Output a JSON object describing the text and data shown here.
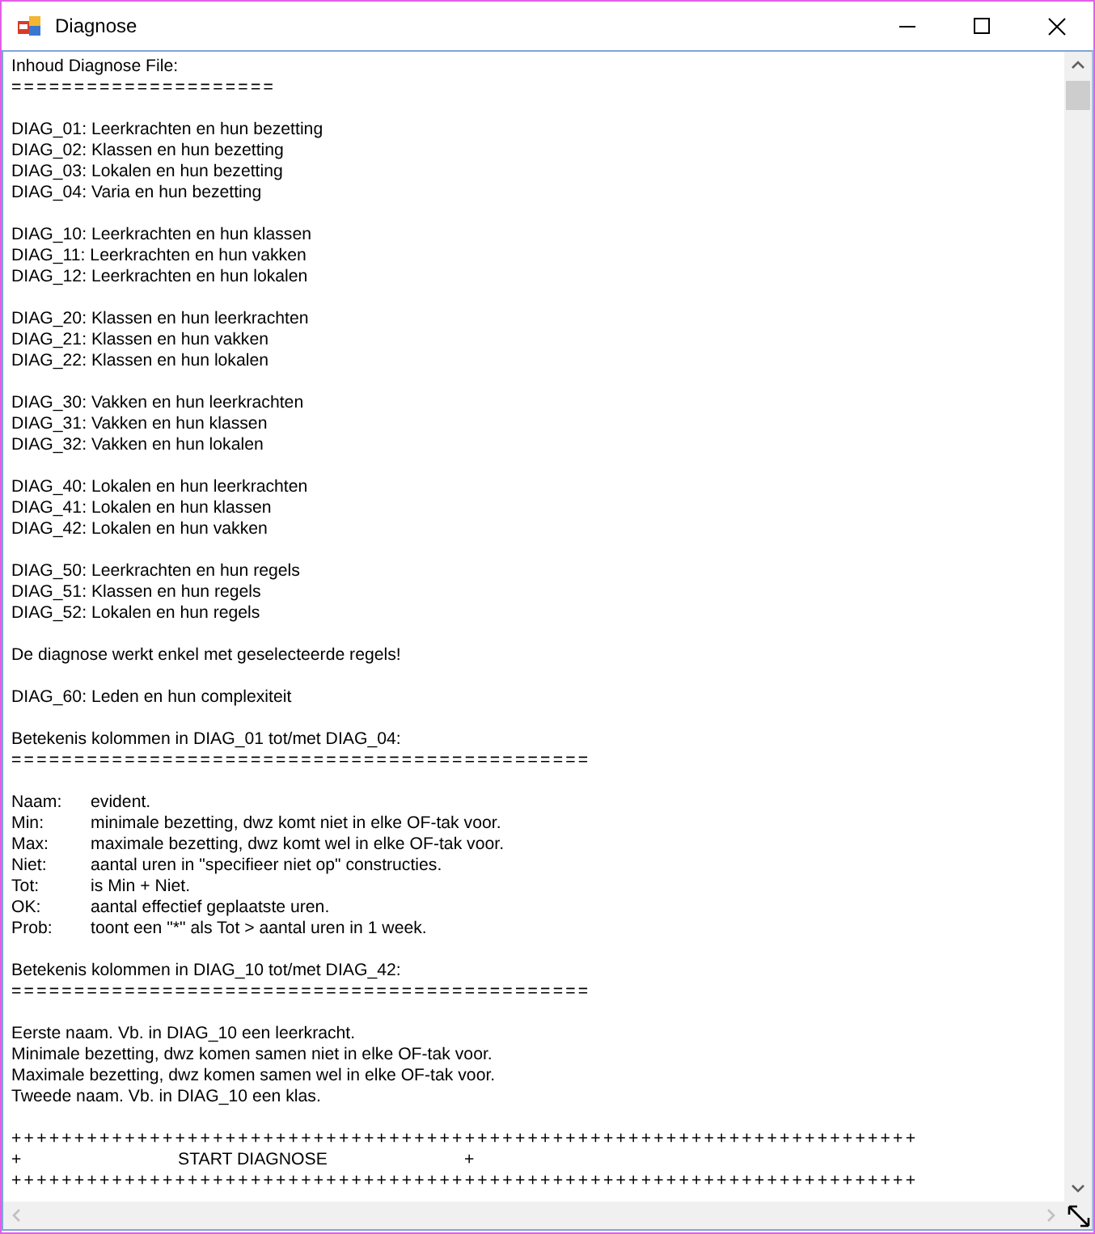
{
  "window": {
    "title": "Diagnose"
  },
  "text_box": {
    "blocks": [
      {
        "kind": "lines",
        "lines": [
          "Inhoud Diagnose File:",
          "====================="
        ]
      },
      {
        "kind": "lines",
        "lines": [
          "DIAG_01: Leerkrachten en hun bezetting",
          "DIAG_02: Klassen en hun bezetting",
          "DIAG_03: Lokalen en hun bezetting",
          "DIAG_04: Varia en hun bezetting"
        ]
      },
      {
        "kind": "lines",
        "lines": [
          "DIAG_10: Leerkrachten en hun klassen",
          "DIAG_11: Leerkrachten en hun vakken",
          "DIAG_12: Leerkrachten en hun lokalen"
        ]
      },
      {
        "kind": "lines",
        "lines": [
          "DIAG_20: Klassen en hun leerkrachten",
          "DIAG_21: Klassen en hun vakken",
          "DIAG_22: Klassen en hun lokalen"
        ]
      },
      {
        "kind": "lines",
        "lines": [
          "DIAG_30: Vakken en hun leerkrachten",
          "DIAG_31: Vakken en hun klassen",
          "DIAG_32: Vakken en hun lokalen"
        ]
      },
      {
        "kind": "lines",
        "lines": [
          "DIAG_40: Lokalen en hun leerkrachten",
          "DIAG_41: Lokalen en hun klassen",
          "DIAG_42: Lokalen en hun vakken"
        ]
      },
      {
        "kind": "lines",
        "lines": [
          "DIAG_50: Leerkrachten en hun regels",
          "DIAG_51: Klassen en hun regels",
          "DIAG_52: Lokalen en hun regels"
        ]
      },
      {
        "kind": "lines",
        "lines": [
          "De diagnose werkt enkel met geselecteerde regels!"
        ]
      },
      {
        "kind": "lines",
        "lines": [
          "DIAG_60: Leden en hun complexiteit"
        ]
      },
      {
        "kind": "lines",
        "lines": [
          "Betekenis kolommen in DIAG_01 tot/met DIAG_04:",
          "=============================================="
        ]
      },
      {
        "kind": "definitions",
        "items": [
          {
            "term": "Naam:",
            "text": "evident."
          },
          {
            "term": "Min:",
            "text": "minimale bezetting, dwz komt niet in elke OF-tak voor."
          },
          {
            "term": "Max:",
            "text": "maximale bezetting, dwz komt wel in elke OF-tak voor."
          },
          {
            "term": "Niet:",
            "text": "aantal uren in \"specifieer niet op\" constructies."
          },
          {
            "term": "Tot:",
            "text": "is Min + Niet."
          },
          {
            "term": "OK:",
            "text": "aantal effectief geplaatste uren."
          },
          {
            "term": "Prob:",
            "text": "toont een \"*\" als Tot > aantal uren in 1 week."
          }
        ]
      },
      {
        "kind": "lines",
        "lines": [
          "Betekenis kolommen in DIAG_10 tot/met DIAG_42:",
          "=============================================="
        ]
      },
      {
        "kind": "lines",
        "lines": [
          "Eerste naam. Vb. in DIAG_10 een leerkracht.",
          "Minimale bezetting, dwz komen samen niet in elke OF-tak voor.",
          "Maximale bezetting, dwz komen samen wel in elke OF-tak voor.",
          "Tweede naam. Vb. in DIAG_10 een klas."
        ]
      },
      {
        "kind": "banner",
        "border": "++++++++++++++++++++++++++++++++++++++++++++++++++++++++++++++++++++++++",
        "edge": "+",
        "title": "START DIAGNOSE"
      }
    ]
  }
}
